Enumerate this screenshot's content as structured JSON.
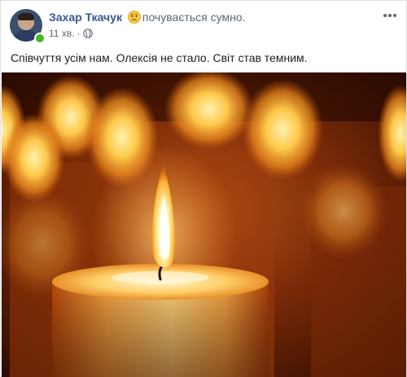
{
  "post": {
    "author": "Захар Ткачук",
    "feeling": "почувається сумно.",
    "feeling_icon": "sad-emoji-icon",
    "timestamp": "11 хв.",
    "separator": "·",
    "privacy_icon": "globe-icon",
    "text": "Співчуття усім нам. Олексія не стало. Світ став темним.",
    "more_icon": "more-options-icon"
  },
  "image": {
    "subject": "candle-photo"
  }
}
